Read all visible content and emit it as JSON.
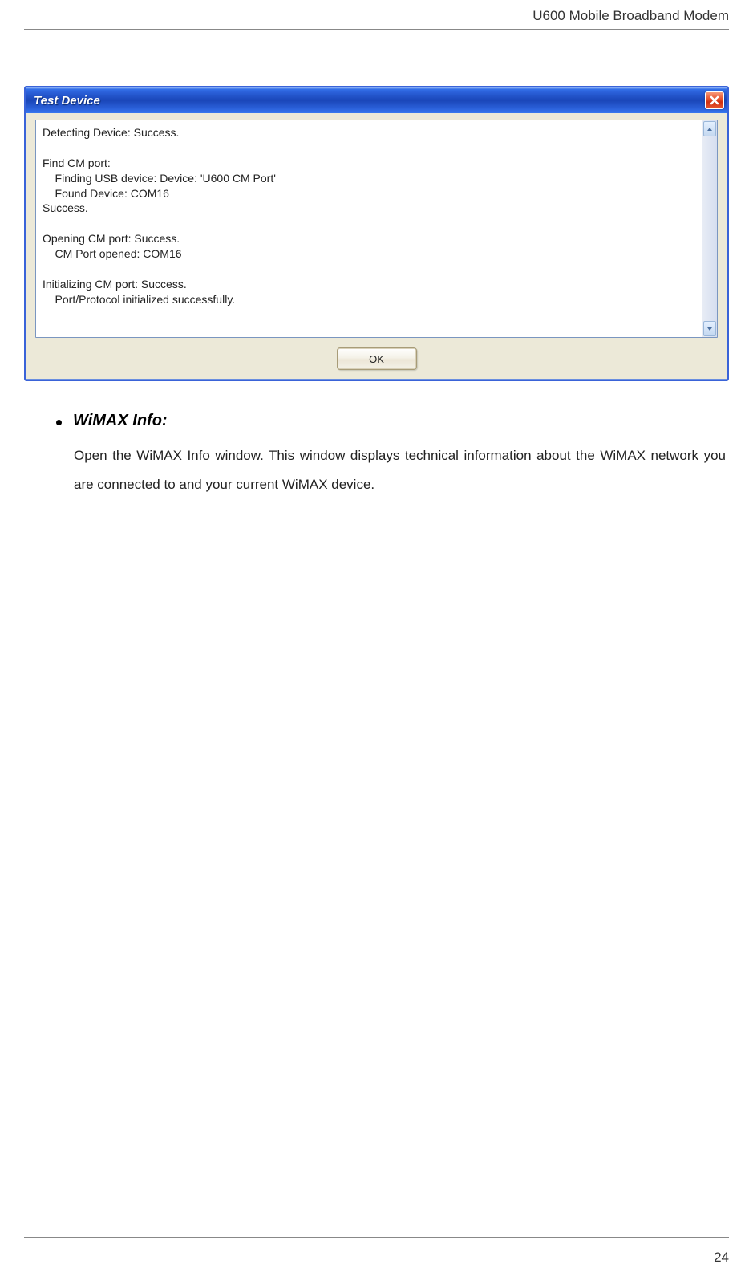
{
  "header": {
    "title": "U600 Mobile Broadband Modem"
  },
  "dialog": {
    "title": "Test Device",
    "lines": [
      "Detecting Device: Success.",
      "",
      "Find CM port:",
      "    Finding USB device: Device: 'U600 CM Port'",
      "    Found Device: COM16",
      "Success.",
      "",
      "Opening CM port: Success.",
      "    CM Port opened: COM16",
      "",
      "Initializing CM port: Success.",
      "    Port/Protocol initialized successfully."
    ],
    "ok_label": "OK"
  },
  "section": {
    "title": "WiMAX Info:",
    "body": "Open the WiMAX Info window. This window displays technical information about the WiMAX network you are connected to and your current WiMAX device."
  },
  "footer": {
    "page": "24"
  }
}
